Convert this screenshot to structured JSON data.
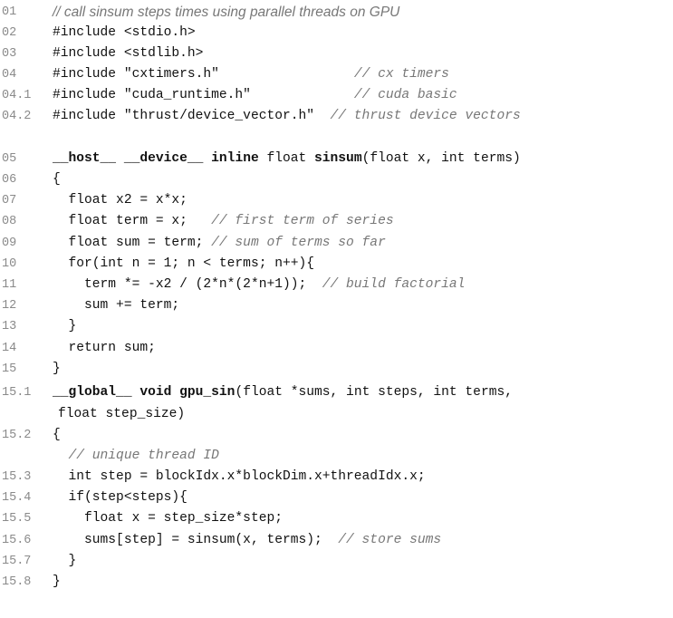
{
  "lines": [
    {
      "n": "01",
      "segs": [
        {
          "t": "// call sinsum steps times using parallel threads on GPU",
          "k": "cs"
        }
      ]
    },
    {
      "n": "02",
      "segs": [
        {
          "t": "#include <stdio.h>",
          "k": "p"
        }
      ]
    },
    {
      "n": "03",
      "segs": [
        {
          "t": "#include <stdlib.h>",
          "k": "p"
        }
      ]
    },
    {
      "n": "04",
      "segs": [
        {
          "t": "#include \"cxtimers.h\"",
          "k": "p"
        },
        {
          "t": "                 ",
          "k": "p"
        },
        {
          "t": "// cx timers",
          "k": "c"
        }
      ]
    },
    {
      "n": "04.1",
      "segs": [
        {
          "t": "#include \"cuda_runtime.h\"",
          "k": "p"
        },
        {
          "t": "             ",
          "k": "p"
        },
        {
          "t": "// cuda basic",
          "k": "c"
        }
      ]
    },
    {
      "n": "04.2",
      "segs": [
        {
          "t": "#include \"thrust/device_vector.h\"",
          "k": "p"
        },
        {
          "t": "  ",
          "k": "p"
        },
        {
          "t": "// thrust device vectors",
          "k": "c"
        }
      ]
    },
    {
      "n": "05",
      "segs": [
        {
          "t": "__host__",
          "k": "b"
        },
        {
          "t": " ",
          "k": "p"
        },
        {
          "t": "__device__",
          "k": "b"
        },
        {
          "t": " ",
          "k": "p"
        },
        {
          "t": "inline",
          "k": "b"
        },
        {
          "t": " float ",
          "k": "p"
        },
        {
          "t": "sinsum",
          "k": "b"
        },
        {
          "t": "(float x, int terms)",
          "k": "p"
        }
      ]
    },
    {
      "n": "06",
      "segs": [
        {
          "t": "{",
          "k": "p"
        }
      ]
    },
    {
      "n": "07",
      "segs": [
        {
          "t": "  float x2 = x*x;",
          "k": "p"
        }
      ]
    },
    {
      "n": "08",
      "segs": [
        {
          "t": "  float term = x;   ",
          "k": "p"
        },
        {
          "t": "// first term of series",
          "k": "c"
        }
      ]
    },
    {
      "n": "09",
      "segs": [
        {
          "t": "  float sum = term; ",
          "k": "p"
        },
        {
          "t": "// sum of terms so far",
          "k": "c"
        }
      ]
    },
    {
      "n": "10",
      "segs": [
        {
          "t": "  for(int n = 1; n < terms; n++){",
          "k": "p"
        }
      ]
    },
    {
      "n": "11",
      "segs": [
        {
          "t": "    term *= -x2 / (2*n*(2*n+1));  ",
          "k": "p"
        },
        {
          "t": "// build factorial",
          "k": "c"
        }
      ]
    },
    {
      "n": "12",
      "segs": [
        {
          "t": "    sum += term;",
          "k": "p"
        }
      ]
    },
    {
      "n": "13",
      "segs": [
        {
          "t": "  }",
          "k": "p"
        }
      ]
    },
    {
      "n": "14",
      "segs": [
        {
          "t": "  return sum;",
          "k": "p"
        }
      ]
    },
    {
      "n": "15",
      "segs": [
        {
          "t": "}",
          "k": "p"
        }
      ]
    },
    {
      "n": "15.1",
      "segs": [
        {
          "t": "__global__",
          "k": "b"
        },
        {
          "t": " ",
          "k": "p"
        },
        {
          "t": "void",
          "k": "b"
        },
        {
          "t": " ",
          "k": "p"
        },
        {
          "t": "gpu_sin",
          "k": "b"
        },
        {
          "t": "(float *sums, int steps, int terms,",
          "k": "p"
        }
      ]
    },
    {
      "n": "",
      "cont": true,
      "segs": [
        {
          "t": "float step_size)",
          "k": "p"
        }
      ]
    },
    {
      "n": "15.2",
      "segs": [
        {
          "t": "{",
          "k": "p"
        }
      ]
    },
    {
      "n": "",
      "segs": [
        {
          "t": "  ",
          "k": "p"
        },
        {
          "t": "// unique thread ID",
          "k": "c"
        }
      ]
    },
    {
      "n": "15.3",
      "segs": [
        {
          "t": "  int step = blockIdx.x*blockDim.x+threadIdx.x;",
          "k": "p"
        }
      ]
    },
    {
      "n": "15.4",
      "segs": [
        {
          "t": "  if(step<steps){",
          "k": "p"
        }
      ]
    },
    {
      "n": "15.5",
      "segs": [
        {
          "t": "    float x = step_size*step;",
          "k": "p"
        }
      ]
    },
    {
      "n": "15.6",
      "segs": [
        {
          "t": "    sums[step] = sinsum(x, terms);  ",
          "k": "p"
        },
        {
          "t": "// store sums",
          "k": "c"
        }
      ]
    },
    {
      "n": "15.7",
      "segs": [
        {
          "t": "  }",
          "k": "p"
        }
      ]
    },
    {
      "n": "15.8",
      "segs": [
        {
          "t": "}",
          "k": "p"
        }
      ]
    }
  ]
}
